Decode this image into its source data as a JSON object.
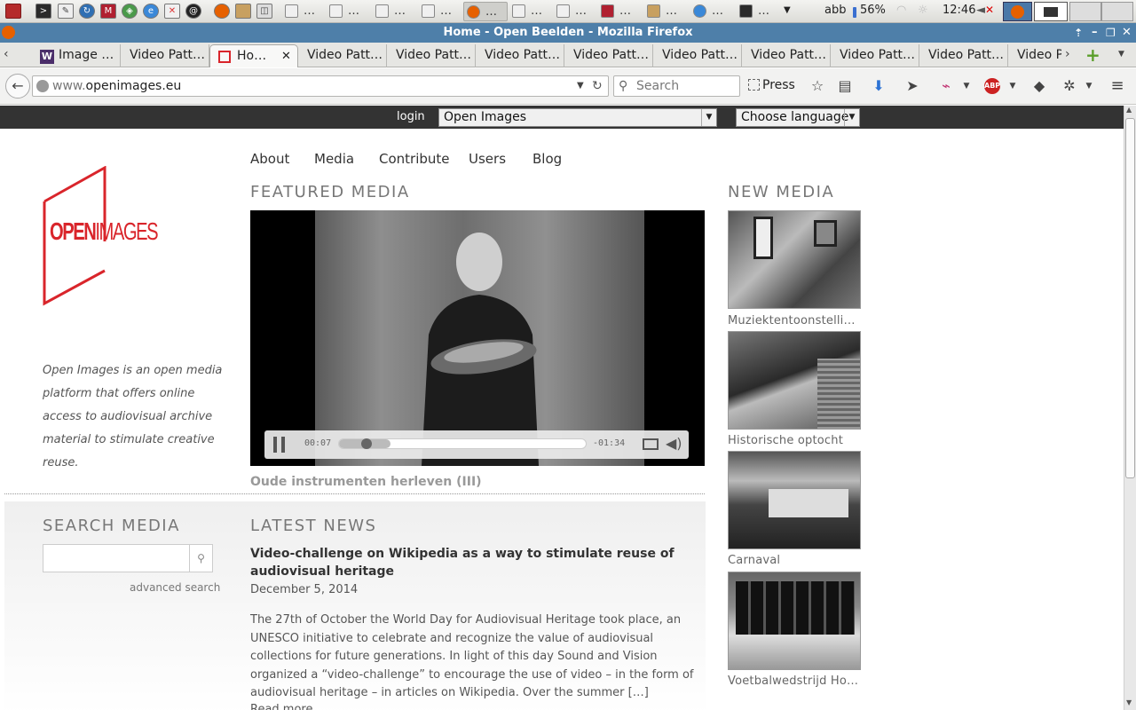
{
  "taskbar": {
    "tasks": [
      "…",
      "…",
      "…",
      "…",
      "…",
      "…",
      "…",
      "…",
      "…",
      "…",
      "…"
    ],
    "user": "abb",
    "battery": "56%",
    "clock": "12:46"
  },
  "window": {
    "title": "Home - Open Beelden - Mozilla Firefox"
  },
  "tabs": [
    {
      "label": "Image …"
    },
    {
      "label": "Video Patt…"
    },
    {
      "label": "Ho…"
    },
    {
      "label": "Video Patt…"
    },
    {
      "label": "Video Patt…"
    },
    {
      "label": "Video Patt…"
    },
    {
      "label": "Video Patt…"
    },
    {
      "label": "Video Patt…"
    },
    {
      "label": "Video Patt…"
    },
    {
      "label": "Video Patt…"
    },
    {
      "label": "Video Patt…"
    },
    {
      "label": "Video P"
    }
  ],
  "navbar": {
    "url_prefix": "www.",
    "url_domain": "openimages.eu",
    "search_placeholder": "Search",
    "press_label": "Press"
  },
  "sitebar": {
    "login": "login",
    "site_select": "Open Images",
    "language_select": "Choose language"
  },
  "site": {
    "logo_open": "OPEN",
    "logo_images": "IMAGES",
    "nav": [
      "About",
      "Media",
      "Contribute",
      "Users",
      "Blog"
    ],
    "tagline": "Open Images is an open media platform that offers online access to audiovisual archive material to stimulate creative reuse.",
    "featured_heading": "FEATURED MEDIA",
    "video": {
      "time_elapsed": "00:07",
      "time_remaining": "-01:34",
      "progress": 0.09,
      "buffered": 0.21,
      "title": "Oude instrumenten herleven (III)"
    },
    "new_media_heading": "NEW MEDIA",
    "new_media": [
      {
        "caption": "Muziektentoonstelling…"
      },
      {
        "caption": "Historische optocht"
      },
      {
        "caption": "Carnaval"
      },
      {
        "caption": "Voetbalwedstrijd Holl…"
      }
    ],
    "search_heading": "SEARCH MEDIA",
    "advanced_search": "advanced search",
    "news_heading": "LATEST NEWS",
    "news": {
      "title": "Video-challenge on Wikipedia as a way to stimulate reuse of audiovisual heritage",
      "date": "December 5, 2014",
      "body": "The 27th of October the World Day for Audiovisual Heritage took place, an UNESCO initiative to celebrate and recognize the value of audiovisual collections for future generations. In light of this day Sound and Vision organized a “video-challenge” to encourage the use of video – in the form of audiovisual heritage – in articles on Wikipedia. Over the summer […]",
      "read_more": "Read more"
    }
  }
}
